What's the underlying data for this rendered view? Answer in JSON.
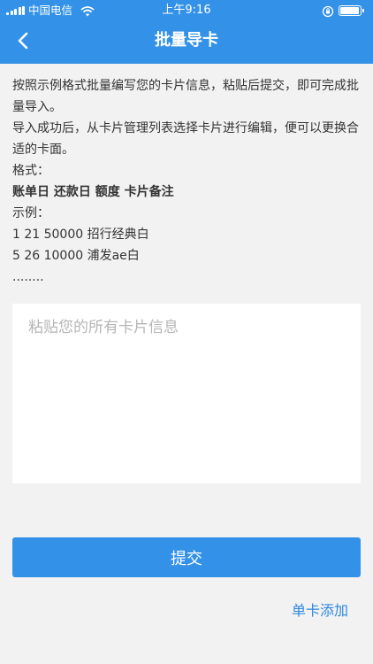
{
  "status_bar": {
    "carrier": "中国电信",
    "time": "上午9:16"
  },
  "header": {
    "title": "批量导卡"
  },
  "instructions": {
    "line1": "按照示例格式批量编写您的卡片信息，粘贴后提交，即可完成批量导入。",
    "line2": "导入成功后，从卡片管理列表选择卡片进行编辑，便可以更换合适的卡面。",
    "format_label": "格式：",
    "format_fields": "账单日 还款日 额度 卡片备注",
    "example_label": "示例：",
    "example1": "1 21 50000 招行经典白",
    "example2": "5 26 10000 浦发ae白",
    "ellipsis": "........"
  },
  "paste": {
    "placeholder": "粘贴您的所有卡片信息",
    "value": ""
  },
  "actions": {
    "submit_label": "提交",
    "single_add_label": "单卡添加"
  },
  "colors": {
    "primary": "#3392e8",
    "background": "#f2f2f2",
    "link": "#2f88e0"
  },
  "icons": {
    "back": "chevron-left-icon",
    "signal": "signal-icon",
    "wifi": "wifi-icon",
    "lock": "rotation-lock-icon",
    "battery": "battery-icon"
  }
}
